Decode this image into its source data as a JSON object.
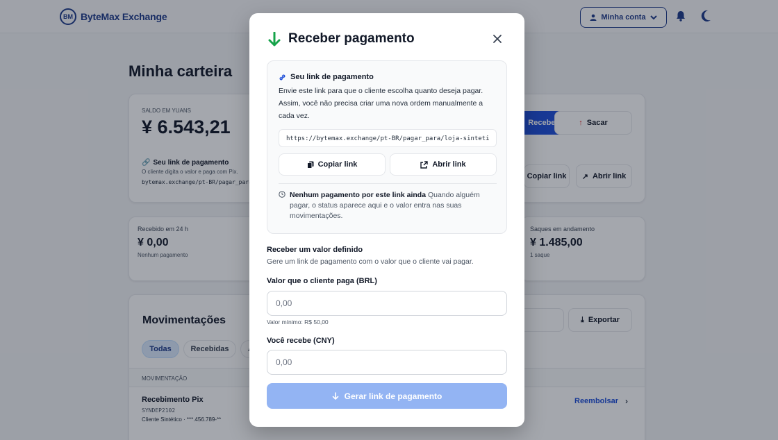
{
  "header": {
    "brand_logo": "BM",
    "brand_name": "ByteMax Exchange",
    "account_label": "Minha conta"
  },
  "page": {
    "title": "Minha carteira",
    "balance_label": "SALDO EM YUANS",
    "balance_value": "¥ 6.543,21",
    "link_title": "Seu link de pagamento",
    "link_desc": "O cliente digita o valor e paga com Pix.",
    "link_url": "bytemax.exchange/pt-BR/pagar_para/loja-sinteti",
    "sacar_label": "Sacar",
    "receber_label": "Receber",
    "copy_link_label": "Copiar link",
    "open_link_label": "Abrir link",
    "stats": [
      {
        "label": "Recebido em 24 h",
        "value": "¥ 0,00",
        "sub": "Nenhum pagamento"
      },
      {
        "label": "Saques em andamento",
        "value": "¥ 1.485,00",
        "sub": "1 saque"
      }
    ],
    "movements_title": "Movimentações",
    "export_label": "Exportar",
    "filters": [
      "Todas",
      "Recebidas",
      "A"
    ],
    "table_header": "MOVIMENTAÇÃO",
    "row": {
      "title": "Recebimento Pix",
      "code": "SYNDEP2102",
      "client": "Cliente Sintético · ***.456.789-**",
      "action": "Reembolsar"
    }
  },
  "modal": {
    "title": "Receber pagamento",
    "link_section": {
      "title": "Seu link de pagamento",
      "description": "Envie este link para que o cliente escolha quanto deseja pagar. Assim, você não precisa criar uma nova ordem manualmente a cada vez.",
      "url": "https://bytemax.exchange/pt-BR/pagar_para/loja-sinteti",
      "copy_label": "Copiar link",
      "open_label": "Abrir link",
      "status_bold": "Nenhum pagamento por este link ainda",
      "status_text": " Quando alguém pagar, o status aparece aqui e o valor entra nas suas movimentações."
    },
    "fixed": {
      "title": "Receber um valor definido",
      "subtitle": "Gere um link de pagamento com o valor que o cliente vai pagar.",
      "amount_label": "Valor que o cliente paga (BRL)",
      "amount_placeholder": "0,00",
      "amount_hint": "Valor mínimo: R$ 50,00",
      "receive_label": "Você recebe (CNY)",
      "receive_placeholder": "0,00",
      "generate_label": "Gerar link de pagamento"
    }
  },
  "colors": {
    "brand": "#1e3a8a",
    "primary": "#1d4ed8",
    "success": "#16a34a",
    "danger": "#dc2626"
  }
}
